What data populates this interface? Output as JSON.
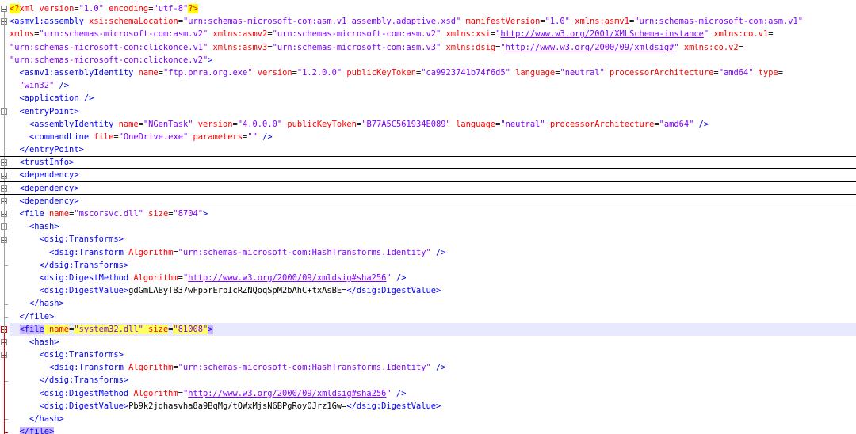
{
  "editor": {
    "lines": [
      {
        "indent": 0,
        "fold": "open",
        "parts": [
          [
            "pi",
            "<?"
          ],
          [
            "piname",
            "xml"
          ],
          [
            "attr",
            " version"
          ],
          [
            "eq",
            "="
          ],
          [
            "val",
            "\"1.0\""
          ],
          [
            "attr",
            " encoding"
          ],
          [
            "eq",
            "="
          ],
          [
            "val",
            "\"utf-8\""
          ],
          [
            "pi",
            "?>"
          ]
        ]
      },
      {
        "indent": 0,
        "fold": "open",
        "parts": [
          [
            "tag",
            "<asmv1:assembly"
          ],
          [
            "attr",
            " xsi:schemaLocation"
          ],
          [
            "eq",
            "="
          ],
          [
            "val",
            "\"urn:schemas-microsoft-com:asm.v1 assembly.adaptive.xsd\""
          ],
          [
            "attr",
            " manifestVersion"
          ],
          [
            "eq",
            "="
          ],
          [
            "val",
            "\"1.0\""
          ],
          [
            "attr",
            " xmlns:asmv1"
          ],
          [
            "eq",
            "="
          ],
          [
            "val",
            "\"urn:schemas-microsoft-com:asm.v1\""
          ]
        ]
      },
      {
        "indent": 0,
        "wrap": true,
        "parts": [
          [
            "attr",
            "xmlns"
          ],
          [
            "eq",
            "="
          ],
          [
            "val",
            "\"urn:schemas-microsoft-com:asm.v2\""
          ],
          [
            "attr",
            " xmlns:asmv2"
          ],
          [
            "eq",
            "="
          ],
          [
            "val",
            "\"urn:schemas-microsoft-com:asm.v2\""
          ],
          [
            "attr",
            " xmlns:xsi"
          ],
          [
            "eq",
            "="
          ],
          [
            "val",
            "\""
          ],
          [
            "link",
            "http://www.w3.org/2001/XMLSchema-instance"
          ],
          [
            "val",
            "\""
          ],
          [
            "attr",
            " xmlns:co.v1"
          ],
          [
            "eq",
            "="
          ]
        ]
      },
      {
        "indent": 0,
        "wrap": true,
        "parts": [
          [
            "val",
            "\"urn:schemas-microsoft-com:clickonce.v1\""
          ],
          [
            "attr",
            " xmlns:asmv3"
          ],
          [
            "eq",
            "="
          ],
          [
            "val",
            "\"urn:schemas-microsoft-com:asm.v3\""
          ],
          [
            "attr",
            " xmlns:dsig"
          ],
          [
            "eq",
            "="
          ],
          [
            "val",
            "\""
          ],
          [
            "link",
            "http://www.w3.org/2000/09/xmldsig#"
          ],
          [
            "val",
            "\""
          ],
          [
            "attr",
            " xmlns:co.v2"
          ],
          [
            "eq",
            "="
          ]
        ]
      },
      {
        "indent": 0,
        "wrap": true,
        "parts": [
          [
            "val",
            "\"urn:schemas-microsoft-com:clickonce.v2\""
          ],
          [
            "tag",
            ">"
          ]
        ]
      },
      {
        "indent": 1,
        "parts": [
          [
            "tag",
            "<asmv1:assemblyIdentity"
          ],
          [
            "attr",
            " name"
          ],
          [
            "eq",
            "="
          ],
          [
            "val",
            "\"ftp.pnra.org.exe\""
          ],
          [
            "attr",
            " version"
          ],
          [
            "eq",
            "="
          ],
          [
            "val",
            "\"1.2.0.0\""
          ],
          [
            "attr",
            " publicKeyToken"
          ],
          [
            "eq",
            "="
          ],
          [
            "val",
            "\"ca9923741b74f6d5\""
          ],
          [
            "attr",
            " language"
          ],
          [
            "eq",
            "="
          ],
          [
            "val",
            "\"neutral\""
          ],
          [
            "attr",
            " processorArchitecture"
          ],
          [
            "eq",
            "="
          ],
          [
            "val",
            "\"amd64\""
          ],
          [
            "attr",
            " type"
          ],
          [
            "eq",
            "="
          ]
        ]
      },
      {
        "indent": 1,
        "wrap": true,
        "parts": [
          [
            "val",
            "\"win32\""
          ],
          [
            "tag",
            " />"
          ]
        ]
      },
      {
        "indent": 1,
        "parts": [
          [
            "tag",
            "<application />"
          ]
        ]
      },
      {
        "indent": 1,
        "fold": "open",
        "parts": [
          [
            "tag",
            "<entryPoint>"
          ]
        ]
      },
      {
        "indent": 2,
        "parts": [
          [
            "tag",
            "<assemblyIdentity"
          ],
          [
            "attr",
            " name"
          ],
          [
            "eq",
            "="
          ],
          [
            "val",
            "\"NGenTask\""
          ],
          [
            "attr",
            " version"
          ],
          [
            "eq",
            "="
          ],
          [
            "val",
            "\"4.0.0.0\""
          ],
          [
            "attr",
            " publicKeyToken"
          ],
          [
            "eq",
            "="
          ],
          [
            "val",
            "\"B77A5C561934E089\""
          ],
          [
            "attr",
            " language"
          ],
          [
            "eq",
            "="
          ],
          [
            "val",
            "\"neutral\""
          ],
          [
            "attr",
            " processorArchitecture"
          ],
          [
            "eq",
            "="
          ],
          [
            "val",
            "\"amd64\""
          ],
          [
            "tag",
            " />"
          ]
        ]
      },
      {
        "indent": 2,
        "parts": [
          [
            "tag",
            "<commandLine"
          ],
          [
            "attr",
            " file"
          ],
          [
            "eq",
            "="
          ],
          [
            "val",
            "\"OneDrive.exe\""
          ],
          [
            "attr",
            " parameters"
          ],
          [
            "eq",
            "="
          ],
          [
            "val",
            "\"\""
          ],
          [
            "tag",
            " />"
          ]
        ]
      },
      {
        "indent": 1,
        "fold": "end",
        "parts": [
          [
            "tag",
            "</entryPoint>"
          ]
        ]
      },
      {
        "indent": 1,
        "fold": "plus",
        "boxed": true,
        "parts": [
          [
            "tag",
            "<trustInfo>"
          ]
        ]
      },
      {
        "indent": 1,
        "fold": "plus",
        "boxed": true,
        "parts": [
          [
            "tag",
            "<dependency>"
          ]
        ]
      },
      {
        "indent": 1,
        "fold": "plus",
        "boxed": true,
        "parts": [
          [
            "tag",
            "<dependency>"
          ]
        ]
      },
      {
        "indent": 1,
        "fold": "plus",
        "boxed": true,
        "parts": [
          [
            "tag",
            "<dependency>"
          ]
        ]
      },
      {
        "indent": 1,
        "fold": "open",
        "parts": [
          [
            "tag",
            "<file"
          ],
          [
            "attr",
            " name"
          ],
          [
            "eq",
            "="
          ],
          [
            "val",
            "\"mscorsvc.dll\""
          ],
          [
            "attr",
            " size"
          ],
          [
            "eq",
            "="
          ],
          [
            "val",
            "\"8704\""
          ],
          [
            "tag",
            ">"
          ]
        ]
      },
      {
        "indent": 2,
        "fold": "open",
        "parts": [
          [
            "tag",
            "<hash>"
          ]
        ]
      },
      {
        "indent": 3,
        "fold": "open",
        "parts": [
          [
            "tag",
            "<dsig:Transforms>"
          ]
        ]
      },
      {
        "indent": 4,
        "parts": [
          [
            "tag",
            "<dsig:Transform"
          ],
          [
            "attr",
            " Algorithm"
          ],
          [
            "eq",
            "="
          ],
          [
            "val",
            "\"urn:schemas-microsoft-com:HashTransforms.Identity\""
          ],
          [
            "tag",
            " />"
          ]
        ]
      },
      {
        "indent": 3,
        "fold": "end",
        "parts": [
          [
            "tag",
            "</dsig:Transforms>"
          ]
        ]
      },
      {
        "indent": 3,
        "parts": [
          [
            "tag",
            "<dsig:DigestMethod"
          ],
          [
            "attr",
            " Algorithm"
          ],
          [
            "eq",
            "="
          ],
          [
            "val",
            "\""
          ],
          [
            "link",
            "http://www.w3.org/2000/09/xmldsig#sha256"
          ],
          [
            "val",
            "\""
          ],
          [
            "tag",
            " />"
          ]
        ]
      },
      {
        "indent": 3,
        "parts": [
          [
            "tag",
            "<dsig:DigestValue>"
          ],
          [
            "text",
            "gdGmLAByTB37wFp5rErpIcRZNQoqSpM2bAhC+txAsBE="
          ],
          [
            "tag",
            "</dsig:DigestValue>"
          ]
        ]
      },
      {
        "indent": 2,
        "fold": "end",
        "parts": [
          [
            "tag",
            "</hash>"
          ]
        ]
      },
      {
        "indent": 1,
        "fold": "end",
        "parts": [
          [
            "tag",
            "</file>"
          ]
        ]
      },
      {
        "indent": 1,
        "fold": "open-red",
        "highlight": true,
        "parts": [
          [
            "match",
            "<file"
          ],
          [
            "matchattr",
            " name"
          ],
          [
            "eq",
            "="
          ],
          [
            "matchval",
            "\"system32.dll\""
          ],
          [
            "matchattr",
            " size"
          ],
          [
            "eq",
            "="
          ],
          [
            "matchval",
            "\"81008\""
          ],
          [
            "match",
            ">"
          ]
        ]
      },
      {
        "indent": 2,
        "fold": "open",
        "parts": [
          [
            "tag",
            "<hash>"
          ]
        ]
      },
      {
        "indent": 3,
        "fold": "open",
        "parts": [
          [
            "tag",
            "<dsig:Transforms>"
          ]
        ]
      },
      {
        "indent": 4,
        "parts": [
          [
            "tag",
            "<dsig:Transform"
          ],
          [
            "attr",
            " Algorithm"
          ],
          [
            "eq",
            "="
          ],
          [
            "val",
            "\"urn:schemas-microsoft-com:HashTransforms.Identity\""
          ],
          [
            "tag",
            " />"
          ]
        ]
      },
      {
        "indent": 3,
        "fold": "end",
        "parts": [
          [
            "tag",
            "</dsig:Transforms>"
          ]
        ]
      },
      {
        "indent": 3,
        "parts": [
          [
            "tag",
            "<dsig:DigestMethod"
          ],
          [
            "attr",
            " Algorithm"
          ],
          [
            "eq",
            "="
          ],
          [
            "val",
            "\""
          ],
          [
            "link",
            "http://www.w3.org/2000/09/xmldsig#sha256"
          ],
          [
            "val",
            "\""
          ],
          [
            "tag",
            " />"
          ]
        ]
      },
      {
        "indent": 3,
        "parts": [
          [
            "tag",
            "<dsig:DigestValue>"
          ],
          [
            "text",
            "Pb9k2jdhasvha8a9BqMg/tQWxMjsN6BPgRoyOJrz1Gw="
          ],
          [
            "tag",
            "</dsig:DigestValue>"
          ]
        ]
      },
      {
        "indent": 2,
        "fold": "end",
        "parts": [
          [
            "tag",
            "</hash>"
          ]
        ]
      },
      {
        "indent": 1,
        "fold": "end-red",
        "parts": [
          [
            "match",
            "</file>"
          ]
        ]
      }
    ]
  },
  "colors": {
    "tag": "#0000ff",
    "attribute": "#ff0000",
    "value": "#8000ff",
    "highlight_line": "#e8e8ff",
    "tag_match": "#c8b4ff"
  }
}
